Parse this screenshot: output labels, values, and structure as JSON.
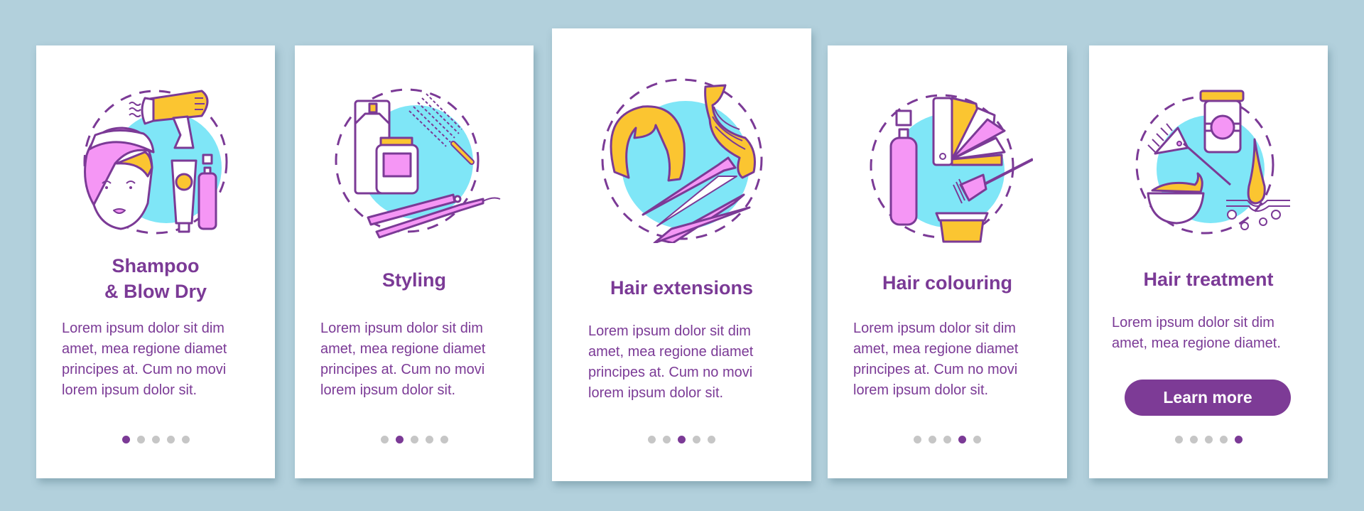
{
  "colors": {
    "background": "#b2d0dc",
    "card": "#ffffff",
    "accent": "#7b3a96",
    "dot_inactive": "#c6c6c6",
    "illustration_blue": "#7fe6f7",
    "illustration_yellow": "#fbc531",
    "illustration_pink": "#f596f5"
  },
  "cards": [
    {
      "title": "Shampoo\n& Blow Dry",
      "body": "Lorem ipsum dolor sit dim\namet, mea regione diamet\nprincipes at. Cum no movi\nlorem ipsum dolor sit.",
      "illustration": "shampoo-blow-dry-illustration",
      "active_dot": 1
    },
    {
      "title": "Styling",
      "body": "Lorem ipsum dolor sit dim\namet, mea regione diamet\nprincipes at. Cum no movi\nlorem ipsum dolor sit.",
      "illustration": "styling-illustration",
      "active_dot": 2
    },
    {
      "title": "Hair extensions",
      "body": "Lorem ipsum dolor sit dim\namet, mea regione diamet\nprincipes at. Cum no movi\nlorem ipsum dolor sit.",
      "illustration": "hair-extensions-illustration",
      "active_dot": 3
    },
    {
      "title": "Hair colouring",
      "body": "Lorem ipsum dolor sit dim\namet, mea regione diamet\nprincipes at. Cum no movi\nlorem ipsum dolor sit.",
      "illustration": "hair-colouring-illustration",
      "active_dot": 4
    },
    {
      "title": "Hair treatment",
      "body": "Lorem ipsum dolor sit dim\namet, mea regione diamet.",
      "illustration": "hair-treatment-illustration",
      "active_dot": 5,
      "button_label": "Learn more"
    }
  ],
  "pagination": {
    "total": 5
  }
}
